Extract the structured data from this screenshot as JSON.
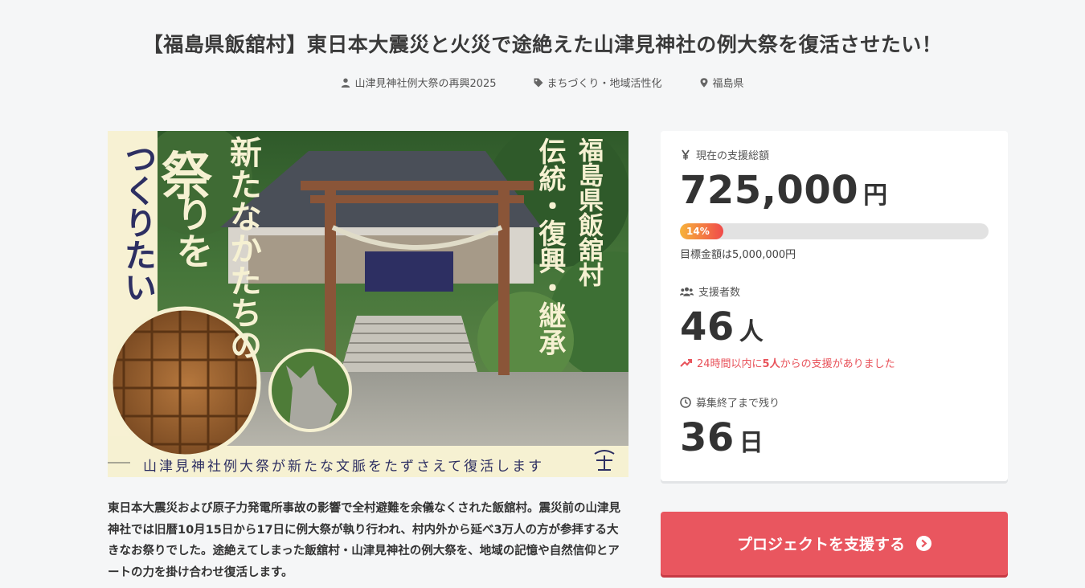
{
  "project": {
    "title": "【福島県飯舘村】東日本大震災と火災で途絶えた山津見神社の例大祭を復活させたい！",
    "owner": "山津見神社例大祭の再興2025",
    "category": "まちづくり・地域活性化",
    "location": "福島県"
  },
  "hero": {
    "vertical_left": "つくりたい",
    "vertical_big": "祭",
    "vertical_ri": "りを",
    "vertical_middle": "新たなかたちの",
    "vertical_right_a": "福島県飯舘村",
    "vertical_right_b": "伝統・復興・継承",
    "banner": "山津見神社例大祭が新たな文脈をたずさえて復活します"
  },
  "description": "東日本大震災および原子力発電所事故の影響で全村避難を余儀なくされた飯舘村。震災前の山津見神社では旧暦10月15日から17日に例大祭が執り行われ、村内外から延べ3万人の方が参拝する大きなお祭りでした。途絶えてしまった飯舘村・山津見神社の例大祭を、地域の記憶や自然信仰とアートの力を掛け合わせ復活します。",
  "stats": {
    "amount_label": "現在の支援総額",
    "amount_value": "725,000",
    "amount_unit": "円",
    "progress_percent": 14,
    "progress_label": "14%",
    "goal_text": "目標金額は5,000,000円",
    "supporters_label": "支援者数",
    "supporters_value": "46",
    "supporters_unit": "人",
    "recent_prefix": "24時間以内に",
    "recent_count": "5人",
    "recent_suffix": "からの支援がありました",
    "remaining_label": "募集終了まで残り",
    "remaining_value": "36",
    "remaining_unit": "日"
  },
  "cta": {
    "label": "プロジェクトを支援する"
  },
  "colors": {
    "accent": "#e9565f",
    "progress_start": "#f7b33b",
    "progress_end": "#f04a4a"
  }
}
